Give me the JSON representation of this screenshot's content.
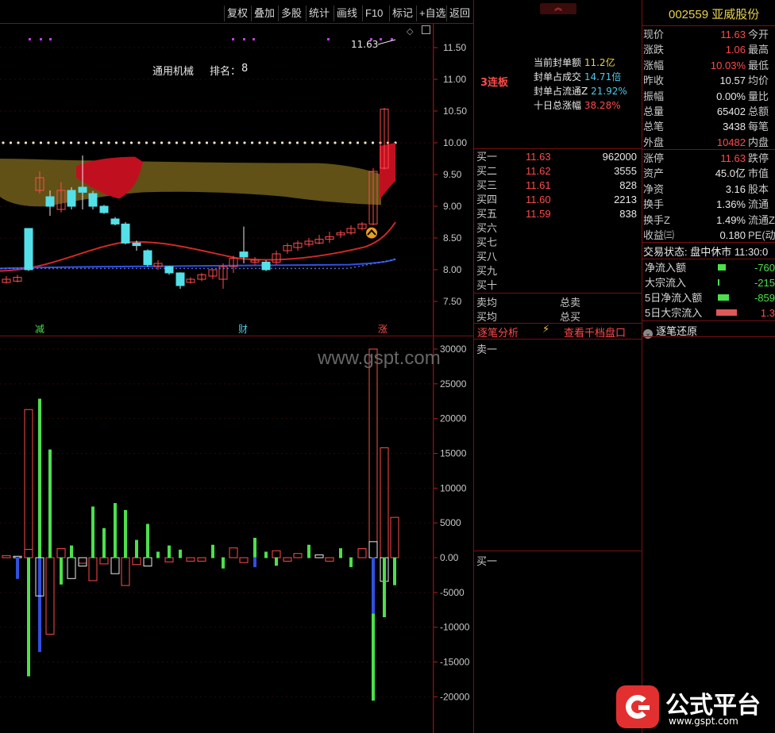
{
  "toolbar": {
    "buttons": [
      "复权",
      "叠加",
      "多股",
      "统计",
      "画线",
      "F10",
      "标记",
      "+自选",
      "返回"
    ]
  },
  "price_axis": [
    "11.50",
    "11.00",
    "10.50",
    "10.00",
    "9.50",
    "9.00",
    "8.50",
    "8.00",
    "7.50"
  ],
  "volume_axis": [
    "30000",
    "25000",
    "20000",
    "15000",
    "10000",
    "5000",
    "0.00",
    "-5000",
    "-10000",
    "-15000",
    "-20000"
  ],
  "chart_labels": {
    "sector": "通用机械",
    "rank_label": "排名：",
    "rank_value": "8",
    "last_price": "11.63",
    "markers": [
      "减",
      "财",
      "涨"
    ]
  },
  "seal_info": {
    "streak": "3连板",
    "rows": [
      {
        "label": "当前封单额",
        "value": "11.2亿"
      },
      {
        "label": "封单占成交",
        "value": "14.71倍"
      },
      {
        "label": "封单占流通Z",
        "value": "21.92%"
      },
      {
        "label": "十日总涨幅",
        "value": "38.28%"
      }
    ]
  },
  "watermark": "www.gspt.com",
  "stock": {
    "code": "002559",
    "name": "亚威股份"
  },
  "quote": [
    {
      "label": "现价",
      "value": "11.63",
      "label2": "今开",
      "color": "red"
    },
    {
      "label": "涨跌",
      "value": "1.06",
      "label2": "最高",
      "color": "red"
    },
    {
      "label": "涨幅",
      "value": "10.03%",
      "label2": "最低",
      "color": "red"
    },
    {
      "label": "昨收",
      "value": "10.57",
      "label2": "均价",
      "color": "white"
    },
    {
      "label": "振幅",
      "value": "0.00%",
      "label2": "量比",
      "color": "white"
    },
    {
      "label": "总量",
      "value": "65402",
      "label2": "总额",
      "color": "white"
    },
    {
      "label": "总笔",
      "value": "3438",
      "label2": "每笔",
      "color": "white"
    },
    {
      "label": "外盘",
      "value": "10482",
      "label2": "内盘",
      "color": "red"
    }
  ],
  "quote2": [
    {
      "label": "涨停",
      "value": "11.63",
      "label2": "跌停",
      "color": "red"
    },
    {
      "label": "资产",
      "value": "45.0亿",
      "label2": "市值",
      "color": "white"
    },
    {
      "label": "净资",
      "value": "3.16",
      "label2": "股本",
      "color": "white"
    },
    {
      "label": "换手",
      "value": "1.36%",
      "label2": "流通",
      "color": "white"
    },
    {
      "label": "换手Z",
      "value": "1.49%",
      "label2": "流通Z",
      "color": "white"
    },
    {
      "label": "收益㈢",
      "value": "0.180",
      "label2": "PE(动)",
      "color": "white"
    }
  ],
  "trade_status": {
    "label": "交易状态:",
    "value": "盘中休市 11:30:0"
  },
  "order_book": {
    "bids": [
      {
        "label": "买一",
        "price": "11.63",
        "vol": "962000"
      },
      {
        "label": "买二",
        "price": "11.62",
        "vol": "3555"
      },
      {
        "label": "买三",
        "price": "11.61",
        "vol": "828"
      },
      {
        "label": "买四",
        "price": "11.60",
        "vol": "2213"
      },
      {
        "label": "买五",
        "price": "11.59",
        "vol": "838"
      },
      {
        "label": "买六",
        "price": "",
        "vol": ""
      },
      {
        "label": "买七",
        "price": "",
        "vol": ""
      },
      {
        "label": "买八",
        "price": "",
        "vol": ""
      },
      {
        "label": "买九",
        "price": "",
        "vol": ""
      },
      {
        "label": "买十",
        "price": "",
        "vol": ""
      }
    ],
    "avg_sell_label": "卖均",
    "total_sell_label": "总卖",
    "avg_buy_label": "买均",
    "total_buy_label": "总买"
  },
  "tabs": {
    "tick_analysis": "逐笔分析",
    "thousand_depth": "查看千档盘口",
    "tick_restore": "逐笔还原"
  },
  "depth_labels": {
    "sell1": "卖一",
    "buy1": "买一"
  },
  "flows": [
    {
      "label": "净流入额",
      "value": "-760",
      "bar_color": "#4ce04c",
      "bar_width": 10
    },
    {
      "label": "大宗流入",
      "value": "-215",
      "bar_color": "#4ce04c",
      "bar_width": 2
    },
    {
      "label": "5日净流入额",
      "value": "-859",
      "bar_color": "#4ce04c",
      "bar_width": 14
    },
    {
      "label": "5日大宗流入",
      "value": "1.3",
      "bar_color": "#e05858",
      "bar_width": 26
    }
  ],
  "logo": {
    "title": "公式平台",
    "url": "www.gspt.com"
  },
  "colors": {
    "up": "#ff4a4a",
    "down": "#4ce04c",
    "cyan": "#54e0e8",
    "grid": "#7a1010"
  }
}
